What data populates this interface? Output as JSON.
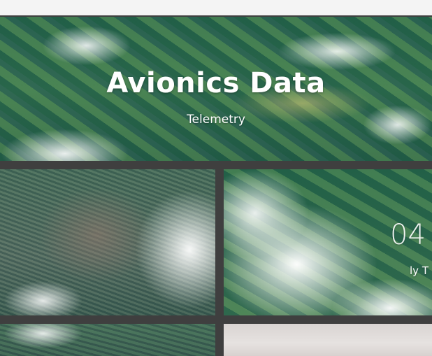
{
  "hero": {
    "title": "Avionics Data",
    "subtitle": "Telemetry"
  },
  "tiles": [
    {
      "number": "",
      "caption": ""
    },
    {
      "number": "04",
      "caption": "ly T"
    },
    {
      "number": "",
      "caption": ""
    },
    {
      "number": "",
      "caption": ""
    }
  ]
}
